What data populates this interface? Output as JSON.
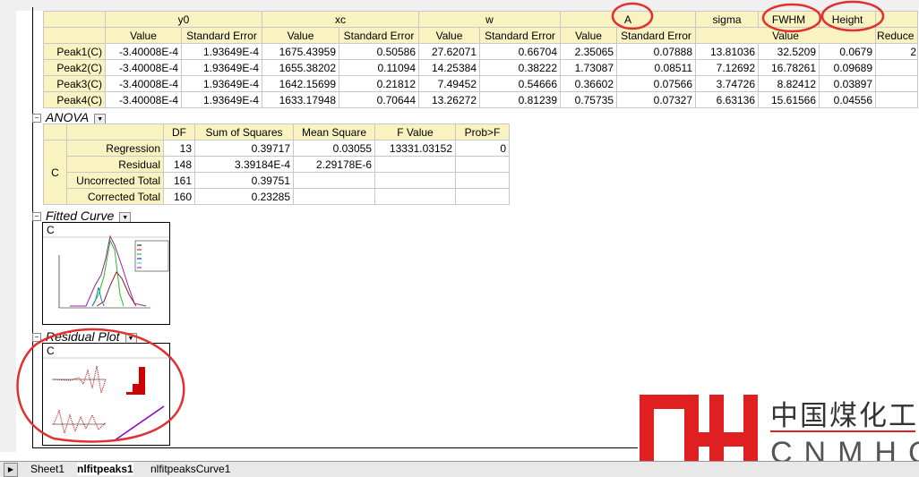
{
  "params_table": {
    "groups": [
      "y0",
      "xc",
      "w",
      "A",
      "sigma",
      "FWHM",
      "Height"
    ],
    "subheaders": {
      "value": "Value",
      "se": "Standard Error",
      "reduced": "Reduce"
    },
    "rows": [
      {
        "name": "Peak1(C)",
        "y0": "-3.40008E-4",
        "y0_se": "1.93649E-4",
        "xc": "1675.43959",
        "xc_se": "0.50586",
        "w": "27.62071",
        "w_se": "0.66704",
        "A": "2.35065",
        "A_se": "0.07888",
        "sigma": "13.81036",
        "fwhm": "32.5209",
        "height": "0.0679",
        "reduced": "2"
      },
      {
        "name": "Peak2(C)",
        "y0": "-3.40008E-4",
        "y0_se": "1.93649E-4",
        "xc": "1655.38202",
        "xc_se": "0.11094",
        "w": "14.25384",
        "w_se": "0.38222",
        "A": "1.73087",
        "A_se": "0.08511",
        "sigma": "7.12692",
        "fwhm": "16.78261",
        "height": "0.09689",
        "reduced": ""
      },
      {
        "name": "Peak3(C)",
        "y0": "-3.40008E-4",
        "y0_se": "1.93649E-4",
        "xc": "1642.15699",
        "xc_se": "0.21812",
        "w": "7.49452",
        "w_se": "0.54666",
        "A": "0.36602",
        "A_se": "0.07566",
        "sigma": "3.74726",
        "fwhm": "8.82412",
        "height": "0.03897",
        "reduced": ""
      },
      {
        "name": "Peak4(C)",
        "y0": "-3.40008E-4",
        "y0_se": "1.93649E-4",
        "xc": "1633.17948",
        "xc_se": "0.70644",
        "w": "13.26272",
        "w_se": "0.81239",
        "A": "0.75735",
        "A_se": "0.07327",
        "sigma": "6.63136",
        "fwhm": "15.61566",
        "height": "0.04556",
        "reduced": ""
      }
    ]
  },
  "anova": {
    "title": "ANOVA",
    "headers": [
      "DF",
      "Sum of Squares",
      "Mean Square",
      "F Value",
      "Prob>F"
    ],
    "group": "C",
    "rows": [
      {
        "label": "Regression",
        "df": "13",
        "ss": "0.39717",
        "ms": "0.03055",
        "f": "13331.03152",
        "p": "0"
      },
      {
        "label": "Residual",
        "df": "148",
        "ss": "3.39184E-4",
        "ms": "2.29178E-6",
        "f": "",
        "p": ""
      },
      {
        "label": "Uncorrected Total",
        "df": "161",
        "ss": "0.39751",
        "ms": "",
        "f": "",
        "p": ""
      },
      {
        "label": "Corrected Total",
        "df": "160",
        "ss": "0.23285",
        "ms": "",
        "f": "",
        "p": ""
      }
    ]
  },
  "fitted_curve": {
    "title": "Fitted Curve",
    "graph_label": "C"
  },
  "residual_plot": {
    "title": "Residual Plot",
    "graph_label": "C"
  },
  "tabs": [
    "Sheet1",
    "nlfitpeaks1",
    "nlfitpeaksCurve1"
  ],
  "active_tab": "nlfitpeaks1",
  "watermark": {
    "cn": "中国煤化工",
    "en": "CNMHG",
    "color": "#e02020"
  },
  "annotation_color": "#e03030"
}
